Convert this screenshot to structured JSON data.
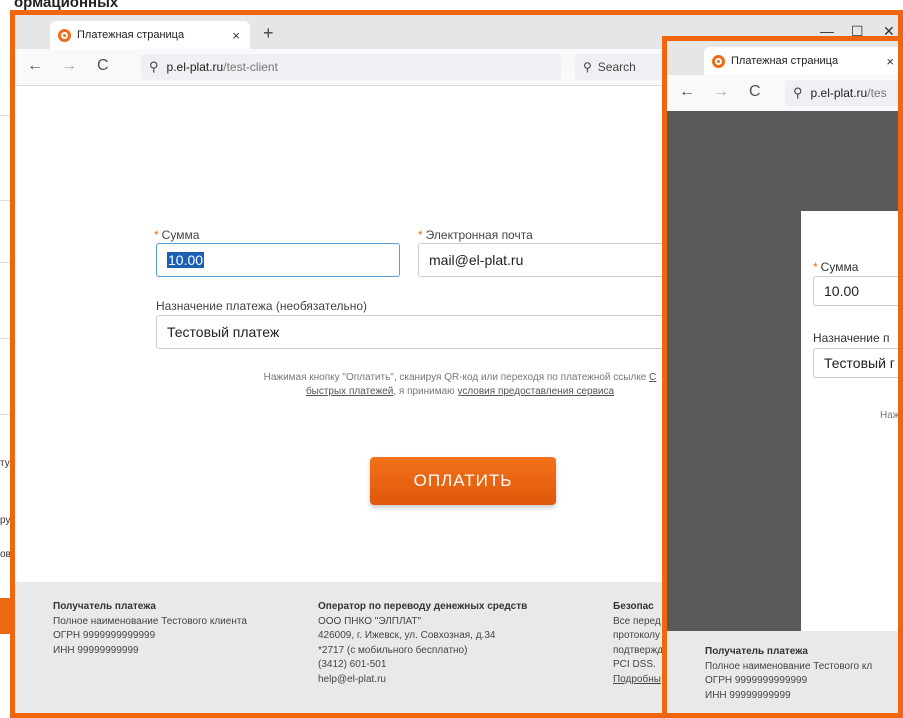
{
  "background_doc": {
    "heading": "ормационных",
    "fragments": [
      "ту",
      "ру",
      "ов"
    ]
  },
  "browser": {
    "tab_title": "Платежная страница",
    "tab_close": "×",
    "new_tab": "+",
    "minimize": "—",
    "maximize": "☐",
    "close": "✕",
    "back": "←",
    "forward": "→",
    "reload": "C",
    "search_icon": "⚲",
    "url_domain": "p.el-plat.ru",
    "url_path": "/test-client",
    "search_label": "Search"
  },
  "form": {
    "amount_required": "*",
    "amount_label": "Сумма",
    "amount_value": "10.00",
    "email_required": "*",
    "email_label": "Электронная почта",
    "email_value": "mail@el-plat.ru",
    "purpose_label": "Назначение платежа (необязательно)",
    "purpose_value": "Тестовый платеж",
    "terms_line1": "Нажимая кнопку \"Оплатить\", сканируя QR-код или переходя по платежной ссылке ",
    "terms_link1_start": "С",
    "terms_link1_rest": "быстрых платежей",
    "terms_mid": ", я принимаю ",
    "terms_link2": "условия предоставления сервиса",
    "pay_button": "ОПЛАТИТЬ"
  },
  "footer": {
    "recipient_title": "Получатель платежа",
    "recipient_lines": [
      "Полное наименование Тестового клиента",
      "ОГРН 9999999999999",
      "ИНН 99999999999"
    ],
    "operator_title": "Оператор по переводу денежных средств",
    "operator_lines": [
      "ООО ПНКО \"ЭЛПЛАТ\"",
      "426009, г. Ижевск, ул. Совхозная, д.34",
      "*2717 (с мобильного бесплатно)",
      "(3412) 601-501",
      "help@el-plat.ru"
    ],
    "security_title": "Безопас",
    "security_lines": [
      "Все перед",
      "протоколу",
      "подтвержд",
      "PCI DSS.",
      "Подробны"
    ]
  },
  "right_window": {
    "tab_title": "Платежная страница",
    "tab_close": "×",
    "url_domain": "p.el-plat.ru",
    "url_path": "/tes",
    "amount_label": "Сумма",
    "amount_value": "10.00",
    "purpose_label": "Назначение п",
    "purpose_value": "Тестовый г",
    "terms_fragment": "Наж",
    "recipient_title": "Получатель платежа",
    "recipient_lines": [
      "Полное наименование Тестового кл",
      "ОГРН 9999999999999",
      "ИНН 99999999999"
    ]
  },
  "colors": {
    "accent": "#f1650c",
    "button": "#ec6a11",
    "selection": "#1a5fb4"
  }
}
